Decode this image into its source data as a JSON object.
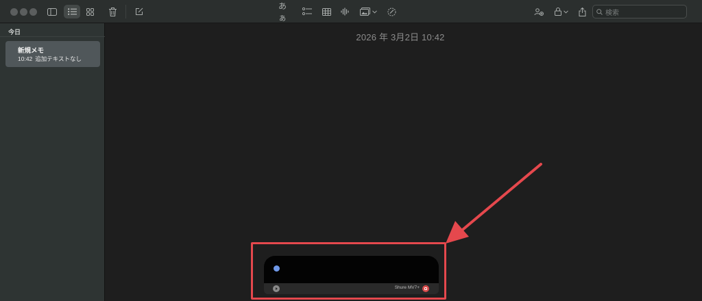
{
  "toolbar": {
    "font_format_icon": "あぁ",
    "search_placeholder": "検索"
  },
  "sidebar": {
    "section_title": "今日",
    "notes": [
      {
        "title": "新規メモ",
        "time": "10:42",
        "preview": "追加テキストなし"
      }
    ]
  },
  "editor": {
    "date": "2026 年 3月2日 10:42"
  },
  "recorder": {
    "device": "Shure MV7+"
  },
  "colors": {
    "annotation": "#e5484d",
    "record_dot": "#6f98e8",
    "stop_button": "#d94b4b"
  }
}
